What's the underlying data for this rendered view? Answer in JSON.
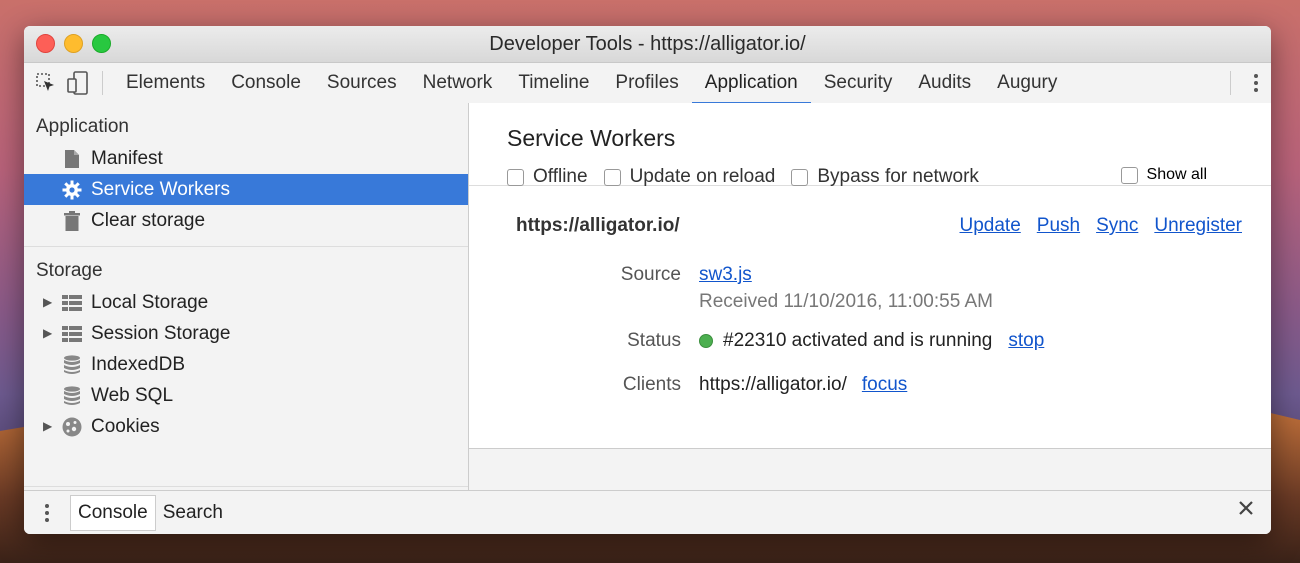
{
  "window": {
    "title": "Developer Tools - https://alligator.io/"
  },
  "toolbar": {
    "tabs": [
      "Elements",
      "Console",
      "Sources",
      "Network",
      "Timeline",
      "Profiles",
      "Application",
      "Security",
      "Audits",
      "Augury"
    ],
    "active_tab": "Application"
  },
  "sidebar": {
    "application_title": "Application",
    "application_items": [
      {
        "label": "Manifest",
        "icon": "document-icon"
      },
      {
        "label": "Service Workers",
        "icon": "gear-icon",
        "selected": true
      },
      {
        "label": "Clear storage",
        "icon": "trash-icon"
      }
    ],
    "storage_title": "Storage",
    "storage_items": [
      {
        "label": "Local Storage",
        "icon": "grid-icon",
        "expandable": true
      },
      {
        "label": "Session Storage",
        "icon": "grid-icon",
        "expandable": true
      },
      {
        "label": "IndexedDB",
        "icon": "database-icon"
      },
      {
        "label": "Web SQL",
        "icon": "database-icon"
      },
      {
        "label": "Cookies",
        "icon": "cookie-icon",
        "expandable": true
      }
    ]
  },
  "service_workers": {
    "title": "Service Workers",
    "checkboxes": {
      "offline": "Offline",
      "update_on_reload": "Update on reload",
      "bypass": "Bypass for network",
      "show_all": "Show all"
    },
    "origin": "https://alligator.io/",
    "actions": {
      "update": "Update",
      "push": "Push",
      "sync": "Sync",
      "unregister": "Unregister"
    },
    "source_label": "Source",
    "source_file": "sw3.js",
    "received": "Received 11/10/2016, 11:00:55 AM",
    "status_label": "Status",
    "status_text": "#22310 activated and is running",
    "status_color": "#4caf50",
    "stop_label": "stop",
    "clients_label": "Clients",
    "client_url": "https://alligator.io/",
    "focus_label": "focus"
  },
  "drawer": {
    "tab_console": "Console",
    "tab_search": "Search"
  },
  "colors": {
    "accent": "#3879d9",
    "link": "#1155cc"
  }
}
